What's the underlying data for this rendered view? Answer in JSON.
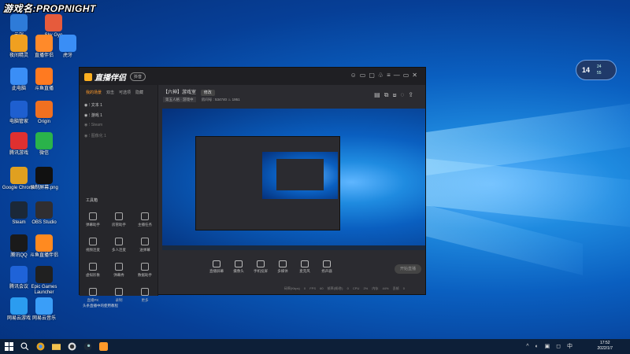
{
  "overlay": {
    "title": "游戏名:PROPNIGHT"
  },
  "desktop_icons": [
    {
      "label": "云端",
      "color": "#2e7bd8"
    },
    {
      "label": "Sky Gyo",
      "color": "#e65b3c"
    },
    {
      "label": "夜间精灵",
      "color": "#f0a020"
    },
    {
      "label": "直播伴侣",
      "color": "#ff8a2a"
    },
    {
      "label": "虎牙",
      "color": "#3a8ef6"
    },
    {
      "label": "此电脑",
      "color": "#3a8ef6"
    },
    {
      "label": "斗鱼直播",
      "color": "#ff7a20"
    },
    {
      "label": "电脑管家",
      "color": "#1e5fd0"
    },
    {
      "label": "Origin",
      "color": "#f07020"
    },
    {
      "label": "腾讯游戏",
      "color": "#e03030"
    },
    {
      "label": "微信",
      "color": "#2ab34a"
    },
    {
      "label": "Google Chrome",
      "color": "#e0a020"
    },
    {
      "label": "录制屏幕.png",
      "color": "#111111"
    },
    {
      "label": "Steam",
      "color": "#1b2838"
    },
    {
      "label": "OBS Studio",
      "color": "#302e31"
    },
    {
      "label": "腾讯QQ",
      "color": "#1a1a1a"
    },
    {
      "label": "斗鱼直播伴侣",
      "color": "#ff8a20"
    },
    {
      "label": "腾讯会议",
      "color": "#1f63d8"
    },
    {
      "label": "Epic Games Launcher",
      "color": "#202020"
    },
    {
      "label": "网易云游戏",
      "color": "#2b9cf0"
    },
    {
      "label": "网易云音乐",
      "color": "#3a9ef8"
    }
  ],
  "weather_widget": {
    "temp": "14",
    "line1": "24",
    "line2": "55"
  },
  "app": {
    "logo": "直播伴侣",
    "version": "抖音",
    "titlebar_icons": [
      "☺",
      "▭",
      "▢",
      "♧",
      "≡",
      "—",
      "▭",
      "✕"
    ],
    "sidebar": {
      "tabs": [
        "我的场景",
        "双击",
        "可选项",
        "隐藏"
      ],
      "scenes": [
        {
          "label": "文本 1",
          "dim": false
        },
        {
          "label": "游戏 1",
          "dim": false
        },
        {
          "label": "Steam",
          "dim": true
        },
        {
          "label": "图像化 1",
          "dim": true
        }
      ],
      "tools_title": "工具箱",
      "tools": [
        {
          "label": "弹幕助手"
        },
        {
          "label": "房管助手"
        },
        {
          "label": "主播任务"
        },
        {
          "label": "视频连麦"
        },
        {
          "label": "多人连麦"
        },
        {
          "label": "送弹幕"
        },
        {
          "label": "虚拟形象"
        },
        {
          "label": "弹幕秀"
        },
        {
          "label": "数据助手"
        },
        {
          "label": "直播PK"
        },
        {
          "label": "录制"
        },
        {
          "label": "更多"
        }
      ],
      "promo": "头条直播中的使用教程"
    },
    "main": {
      "title": "【六神】游戏室",
      "title_btn": "修改",
      "sub_tag": "第五人格 · 游戏中",
      "sub_info": "房间号 : 534740   ♨ 1951",
      "head_icons": [
        "▤",
        "⧉",
        "⧈",
        "◌",
        "⇪"
      ]
    },
    "controls": [
      {
        "label": "直播屏幕"
      },
      {
        "label": "摄像头"
      },
      {
        "label": "手机投屏"
      },
      {
        "label": "多媒体"
      },
      {
        "label": "麦克风"
      },
      {
        "label": "扬声器"
      }
    ],
    "start_button": "开始直播",
    "status_text": "码率(Kbps) 0  FPS 60  帧率(帧/秒) 0  CPU 2%  内存 44%  丢帧 0"
  },
  "taskbar": {
    "time": "17:52",
    "date": "2022/1/7",
    "tray": "^ ◐ ▣ ◻ 中"
  }
}
